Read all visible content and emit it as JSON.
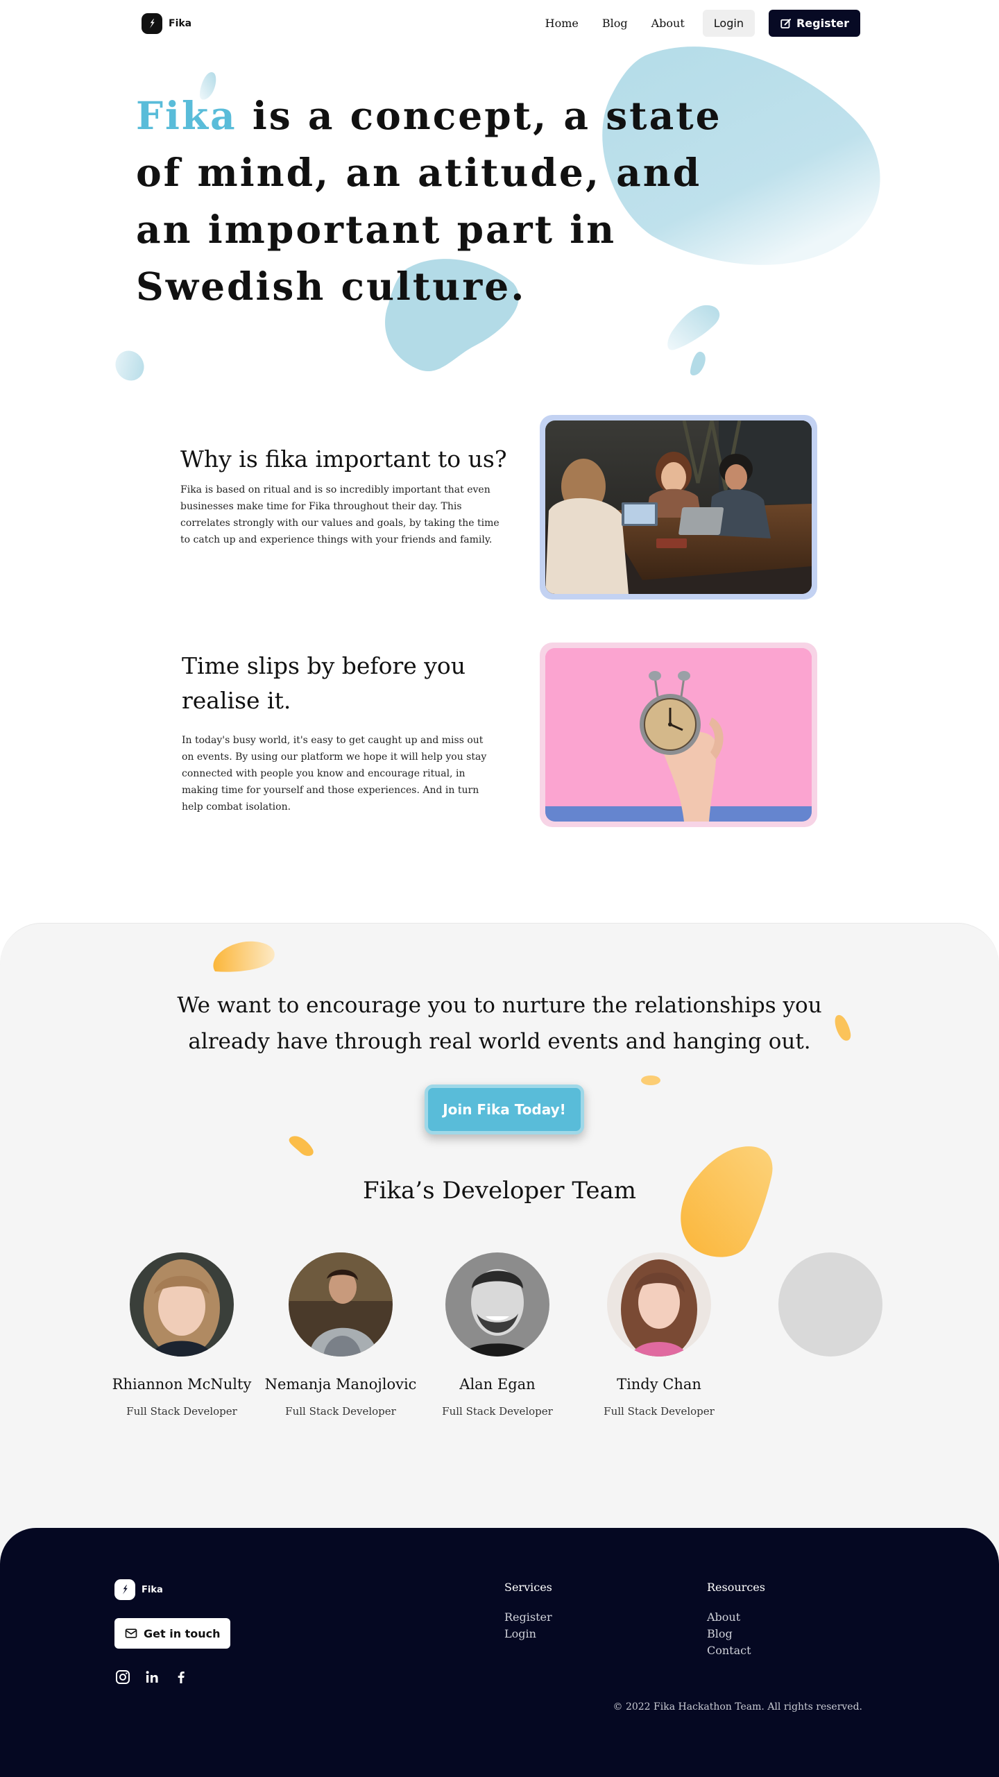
{
  "nav": {
    "brand": "Fika",
    "links": [
      "Home",
      "Blog",
      "About"
    ],
    "login": "Login",
    "register": "Register"
  },
  "hero": {
    "accent_word": "Fika",
    "title_rest": " is a concept, a state of mind, an atitude, and an important part in Swedish culture."
  },
  "features": [
    {
      "title": "Why is fika important to us?",
      "body": "Fika is based on ritual and is so incredibly important that even businesses make time for Fika throughout their day. This correlates strongly with our values and goals, by taking the time to catch up and experience things with your friends and family.",
      "image": "friends-at-cafe-photo"
    },
    {
      "title": "Time slips by before you realise it.",
      "body": " In today's busy world, it's easy to get caught up and miss out on events. By using our platform we hope it will help you stay connected with people you know and encourage ritual, in making time for yourself and those experiences. And in turn help combat isolation.",
      "image": "hand-holding-clock-photo"
    }
  ],
  "mission": {
    "text": "We want to encourage you to nurture the relationships you already have through real world events and hanging out.",
    "cta": "Join Fika Today!"
  },
  "team": {
    "title": "Fika’s Developer Team",
    "members": [
      {
        "name": "Rhiannon McNulty",
        "role": "Full Stack Developer"
      },
      {
        "name": "Nemanja Manojlovic",
        "role": "Full Stack Developer"
      },
      {
        "name": "Alan Egan",
        "role": "Full Stack Developer"
      },
      {
        "name": "Tindy Chan",
        "role": "Full Stack Developer"
      }
    ]
  },
  "footer": {
    "brand": "Fika",
    "touch": "Get in touch",
    "socials": [
      "instagram-icon",
      "linkedin-icon",
      "facebook-icon"
    ],
    "services": {
      "title": "Services",
      "links": [
        "Register",
        "Login"
      ]
    },
    "resources": {
      "title": "Resources",
      "links": [
        "About",
        "Blog",
        "Contact"
      ]
    },
    "copyright": "© 2022 Fika Hackathon Team. All rights reserved."
  },
  "colors": {
    "accent_blue": "#59bcd9",
    "accent_orange": "#fbbf4a",
    "navy": "#050822",
    "light_bg": "#f5f5f5"
  }
}
